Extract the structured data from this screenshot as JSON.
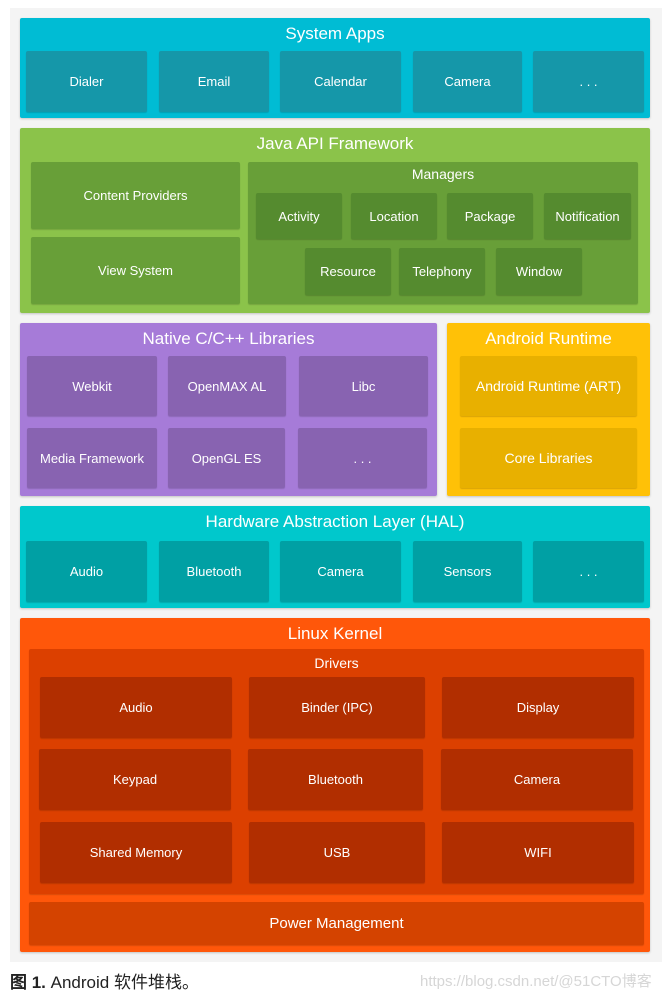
{
  "colors": {
    "panel": "#f4f4f4",
    "system_apps": "#00bcd4",
    "system_apps_item": "#1597a9",
    "java_api": "#8bc34a",
    "java_api_item": "#689f38",
    "managers_item": "#558b2f",
    "native": "#a67bd8",
    "native_item": "#8863b1",
    "runtime": "#ffc107",
    "runtime_item": "#e8b000",
    "hal": "#00c8cc",
    "hal_item": "#00a0a4",
    "kernel": "#ff570a",
    "drivers": "#dc4000",
    "drivers_item": "#b12e00",
    "power": "#d44300"
  },
  "system_apps": {
    "title": "System Apps",
    "items": [
      "Dialer",
      "Email",
      "Calendar",
      "Camera",
      ". . ."
    ]
  },
  "java_api": {
    "title": "Java API Framework",
    "content_providers": "Content Providers",
    "view_system": "View System",
    "managers": {
      "title": "Managers",
      "items": [
        "Activity",
        "Location",
        "Package",
        "Notification",
        "Resource",
        "Telephony",
        "Window"
      ]
    }
  },
  "native_libs": {
    "title": "Native C/C++ Libraries",
    "items": [
      "Webkit",
      "OpenMAX AL",
      "Libc",
      "Media Framework",
      "OpenGL ES",
      ". . ."
    ]
  },
  "runtime": {
    "title": "Android Runtime",
    "items": [
      "Android Runtime (ART)",
      "Core Libraries"
    ]
  },
  "hal": {
    "title": "Hardware Abstraction Layer (HAL)",
    "items": [
      "Audio",
      "Bluetooth",
      "Camera",
      "Sensors",
      ". . ."
    ]
  },
  "kernel": {
    "title": "Linux Kernel",
    "drivers": {
      "title": "Drivers",
      "items": [
        "Audio",
        "Binder (IPC)",
        "Display",
        "Keypad",
        "Bluetooth",
        "Camera",
        "Shared Memory",
        "USB",
        "WIFI"
      ]
    },
    "power": "Power Management"
  },
  "caption": {
    "label": "图 1.",
    "text": " Android 软件堆栈。"
  },
  "watermark": "https://blog.csdn.net/@51CTO博客"
}
